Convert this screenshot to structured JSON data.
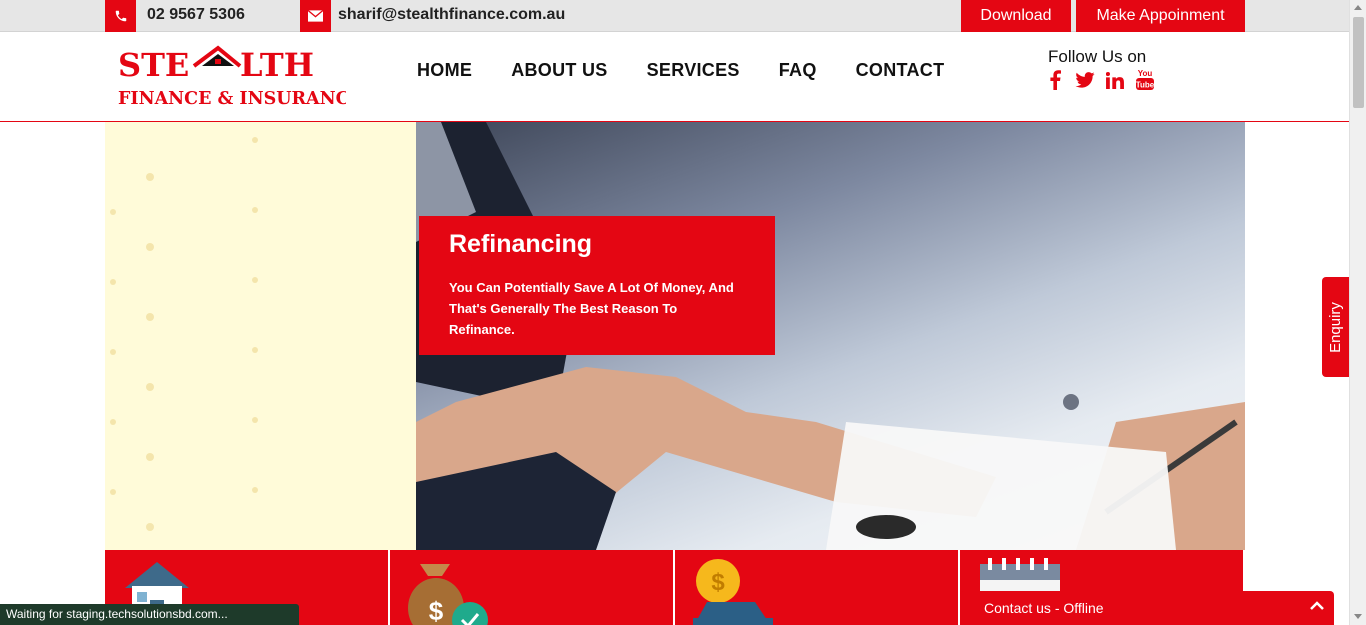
{
  "topbar": {
    "phone": "02 9567 5306",
    "email": "sharif@stealthfinance.com.au",
    "download_label": "Download",
    "appointment_label": "Make Appoinment",
    "phone_icon": "phone-icon",
    "email_icon": "envelope-icon"
  },
  "logo": {
    "line1_left": "STE",
    "line1_right": "LTH",
    "line2": "FINANCE & INSURANCE"
  },
  "nav": {
    "items": [
      "HOME",
      "ABOUT US",
      "SERVICES",
      "FAQ",
      "CONTACT"
    ]
  },
  "social": {
    "heading": "Follow Us on",
    "icons": [
      "facebook-icon",
      "twitter-icon",
      "linkedin-icon",
      "youtube-icon"
    ],
    "facebook_glyph": "f",
    "twitter_glyph": "t",
    "linkedin_glyph": "in",
    "youtube_glyph": "You\nTube"
  },
  "hero": {
    "title": "Refinancing",
    "body": "You Can Potentially Save A Lot Of Money, And That's Generally The Best Reason To Refinance."
  },
  "tiles": {
    "icons": [
      "house-icon",
      "money-bag-icon",
      "car-loan-icon",
      "calendar-icon"
    ]
  },
  "enquiry_label": "Enquiry",
  "chat": {
    "label": "Contact us - Offline"
  },
  "status_text": "Waiting for staging.techsolutionsbd.com...",
  "colors": {
    "brand_red": "#e40613",
    "topbar_bg": "#e6e6e6",
    "hero_left_bg": "#fffbd9"
  }
}
